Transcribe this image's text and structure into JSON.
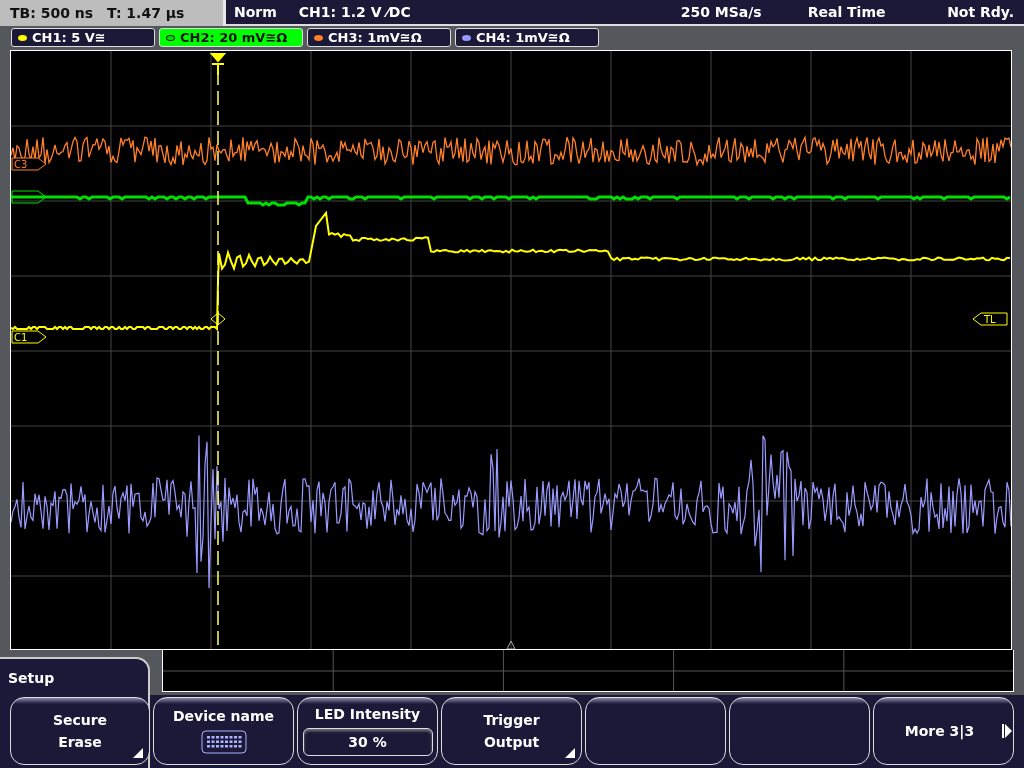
{
  "status_bar": {
    "timebase": "TB: 500 ns",
    "trigger_time": "T: 1.47 µs",
    "trigger_mode": "Norm",
    "trigger_source": "CH1: 1.2 V ⁄DC",
    "sample_rate": "250 MSa/s",
    "acquisition": "Real Time",
    "state": "Not Rdy."
  },
  "channels": [
    {
      "label": "CH1: 5 V≅",
      "color": "#ffff00",
      "selected": false
    },
    {
      "label": "CH2: 20 mV≅Ω",
      "color": "#00e000",
      "selected": true
    },
    {
      "label": "CH3: 1mV≅Ω",
      "color": "#ff7f2a",
      "selected": false
    },
    {
      "label": "CH4: 1mV≅Ω",
      "color": "#9a9aff",
      "selected": false
    }
  ],
  "markers": [
    {
      "label": "C3",
      "color": "#ff7f2a"
    },
    {
      "label": "C1",
      "color": "#ffff00"
    },
    {
      "label": "TL",
      "color": "#ffff00"
    }
  ],
  "menu": {
    "title": "Setup"
  },
  "softkeys": [
    {
      "kind": "text",
      "lines": [
        "Secure",
        "Erase"
      ],
      "submenu": true
    },
    {
      "kind": "keyboard",
      "label": "Device name"
    },
    {
      "kind": "value",
      "label": "LED Intensity",
      "value": "30 %"
    },
    {
      "kind": "text",
      "lines": [
        "Trigger",
        "Output"
      ],
      "submenu": true
    },
    {
      "kind": "empty"
    },
    {
      "kind": "empty"
    },
    {
      "kind": "more",
      "label": "More 3|3"
    }
  ]
}
